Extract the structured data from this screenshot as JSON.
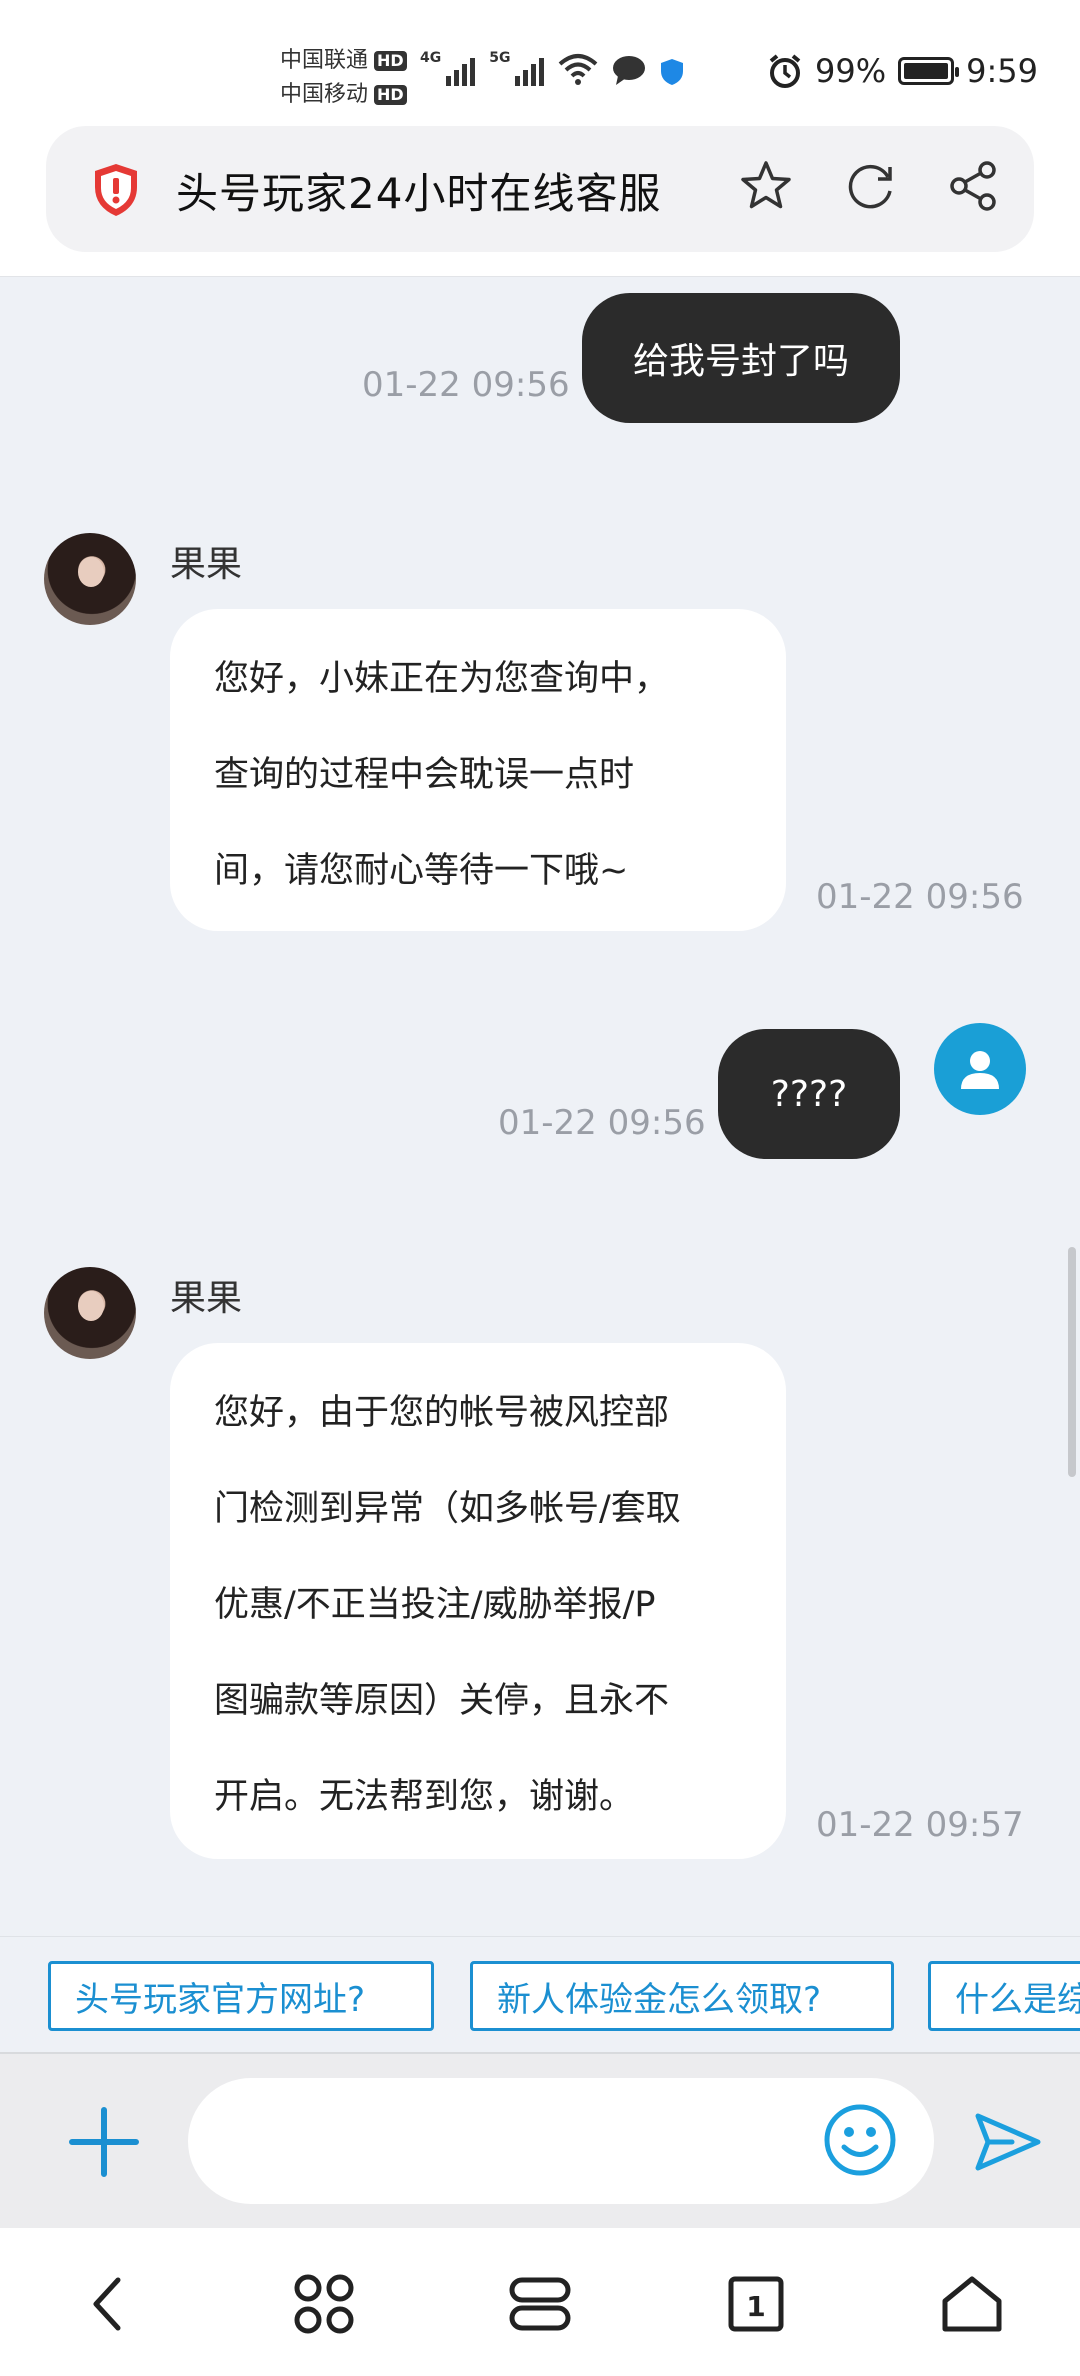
{
  "status_bar": {
    "carrier1": "中国联通",
    "carrier2": "中国移动",
    "hd": "HD",
    "net1": "4G",
    "net2": "5G",
    "battery_text": "99%",
    "battery_level": 0.99,
    "time": "9:59"
  },
  "url_bar": {
    "title": "头号玩家24小时在线客服"
  },
  "chat": {
    "messages": [
      {
        "side": "out",
        "text": "给我号封了吗",
        "time": "01-22 09:56"
      },
      {
        "side": "in",
        "sender": "果果",
        "lines": [
          "您好，小妹正在为您查询中，",
          "查询的过程中会耽误一点时",
          "间，请您耐心等待一下哦~"
        ],
        "time": "01-22 09:56"
      },
      {
        "side": "out",
        "text": "????",
        "time": "01-22 09:56"
      },
      {
        "side": "in",
        "sender": "果果",
        "lines": [
          "您好，由于您的帐号被风控部",
          "门检测到异常（如多帐号/套取",
          "优惠/不正当投注/威胁举报/P",
          "图骗款等原因）关停，且永不",
          "开启。无法帮到您，谢谢。"
        ],
        "time": "01-22 09:57"
      }
    ]
  },
  "quick_replies": [
    "头号玩家官方网址?",
    "新人体验金怎么领取?",
    "什么是综"
  ],
  "input": {
    "placeholder": ""
  },
  "nav": {
    "tabs_count": "1"
  },
  "colors": {
    "accent": "#1b8fd1",
    "out_bubble": "#2b2b2b",
    "chat_bg": "#eef1f6",
    "user_avatar": "#1a9fd6"
  }
}
